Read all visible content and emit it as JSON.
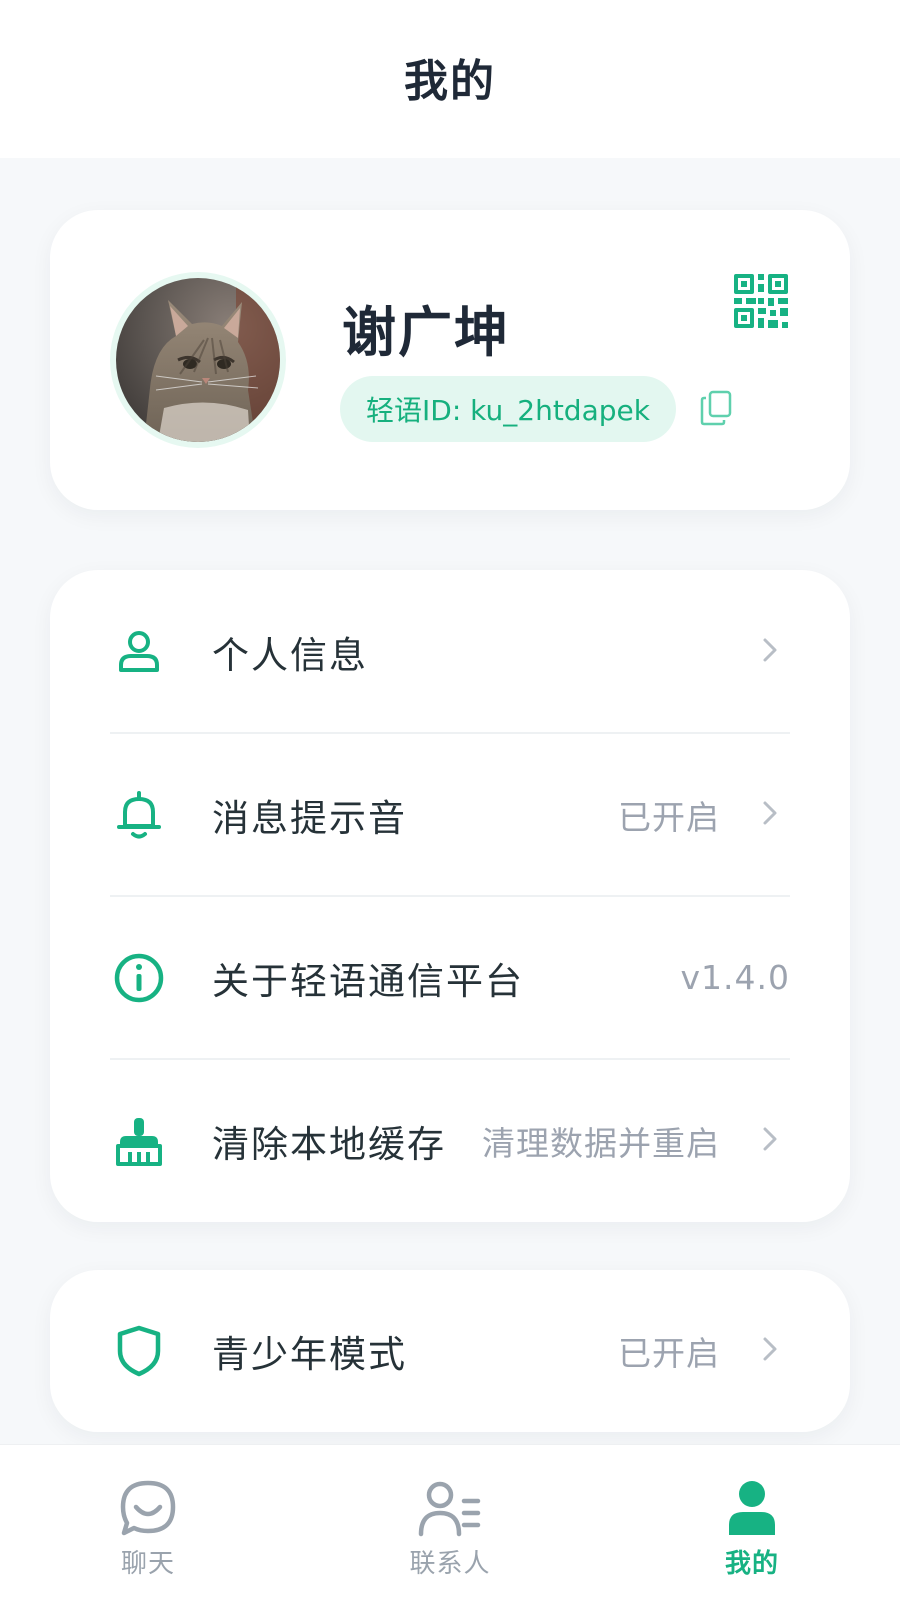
{
  "header": {
    "title": "我的"
  },
  "profile": {
    "name": "谢广坤",
    "id_label": "轻语ID: ku_2htdapek"
  },
  "menu": {
    "items": [
      {
        "label": "个人信息",
        "value": "",
        "icon": "user-icon"
      },
      {
        "label": "消息提示音",
        "value": "已开启",
        "icon": "bell-icon"
      },
      {
        "label": "关于轻语通信平台",
        "value": "v1.4.0",
        "icon": "info-icon"
      },
      {
        "label": "清除本地缓存",
        "value": "清理数据并重启",
        "icon": "broom-icon"
      }
    ]
  },
  "youth": {
    "label": "青少年模式",
    "value": "已开启",
    "icon": "shield-icon"
  },
  "tabs": [
    {
      "label": "聊天",
      "icon": "chat-icon",
      "active": false
    },
    {
      "label": "联系人",
      "icon": "contacts-icon",
      "active": false
    },
    {
      "label": "我的",
      "icon": "me-icon",
      "active": true
    }
  ],
  "colors": {
    "accent": "#17b283",
    "background": "#f6f8fa",
    "card": "#ffffff",
    "muted": "#9ca3af"
  }
}
